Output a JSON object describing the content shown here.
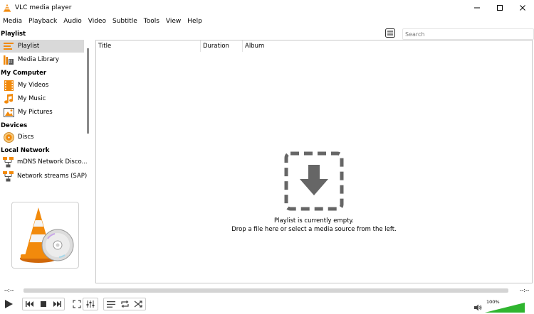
{
  "window": {
    "title": "VLC media player"
  },
  "menu": [
    "Media",
    "Playback",
    "Audio",
    "Video",
    "Subtitle",
    "Tools",
    "View",
    "Help"
  ],
  "sidebar": {
    "sections": [
      {
        "header": "Playlist",
        "items": [
          {
            "label": "Playlist",
            "icon": "playlist-icon",
            "selected": true
          },
          {
            "label": "Media Library",
            "icon": "media-library-icon",
            "selected": false
          }
        ]
      },
      {
        "header": "My Computer",
        "items": [
          {
            "label": "My Videos",
            "icon": "film-icon",
            "selected": false
          },
          {
            "label": "My Music",
            "icon": "music-note-icon",
            "selected": false
          },
          {
            "label": "My Pictures",
            "icon": "picture-icon",
            "selected": false
          }
        ]
      },
      {
        "header": "Devices",
        "items": [
          {
            "label": "Discs",
            "icon": "disc-icon",
            "selected": false
          }
        ]
      },
      {
        "header": "Local Network",
        "items": [
          {
            "label": "mDNS Network Disco...",
            "icon": "network-icon",
            "selected": false
          },
          {
            "label": "Network streams (SAP)",
            "icon": "network-icon",
            "selected": false
          }
        ]
      }
    ]
  },
  "search": {
    "placeholder": "Search",
    "value": ""
  },
  "playlist": {
    "columns": [
      "Title",
      "Duration",
      "Album"
    ],
    "empty_line1": "Playlist is currently empty.",
    "empty_line2": "Drop a file here or select a media source from the left."
  },
  "seek": {
    "elapsed": "--:--",
    "remaining": "--:--",
    "progress": 0
  },
  "volume": {
    "label": "100%",
    "level": 1.0
  },
  "colors": {
    "vlc_orange": "#f28a0c",
    "volume_green": "#2fb52f",
    "icon_gray": "#555555",
    "selected_bg": "#d9d9d9"
  }
}
